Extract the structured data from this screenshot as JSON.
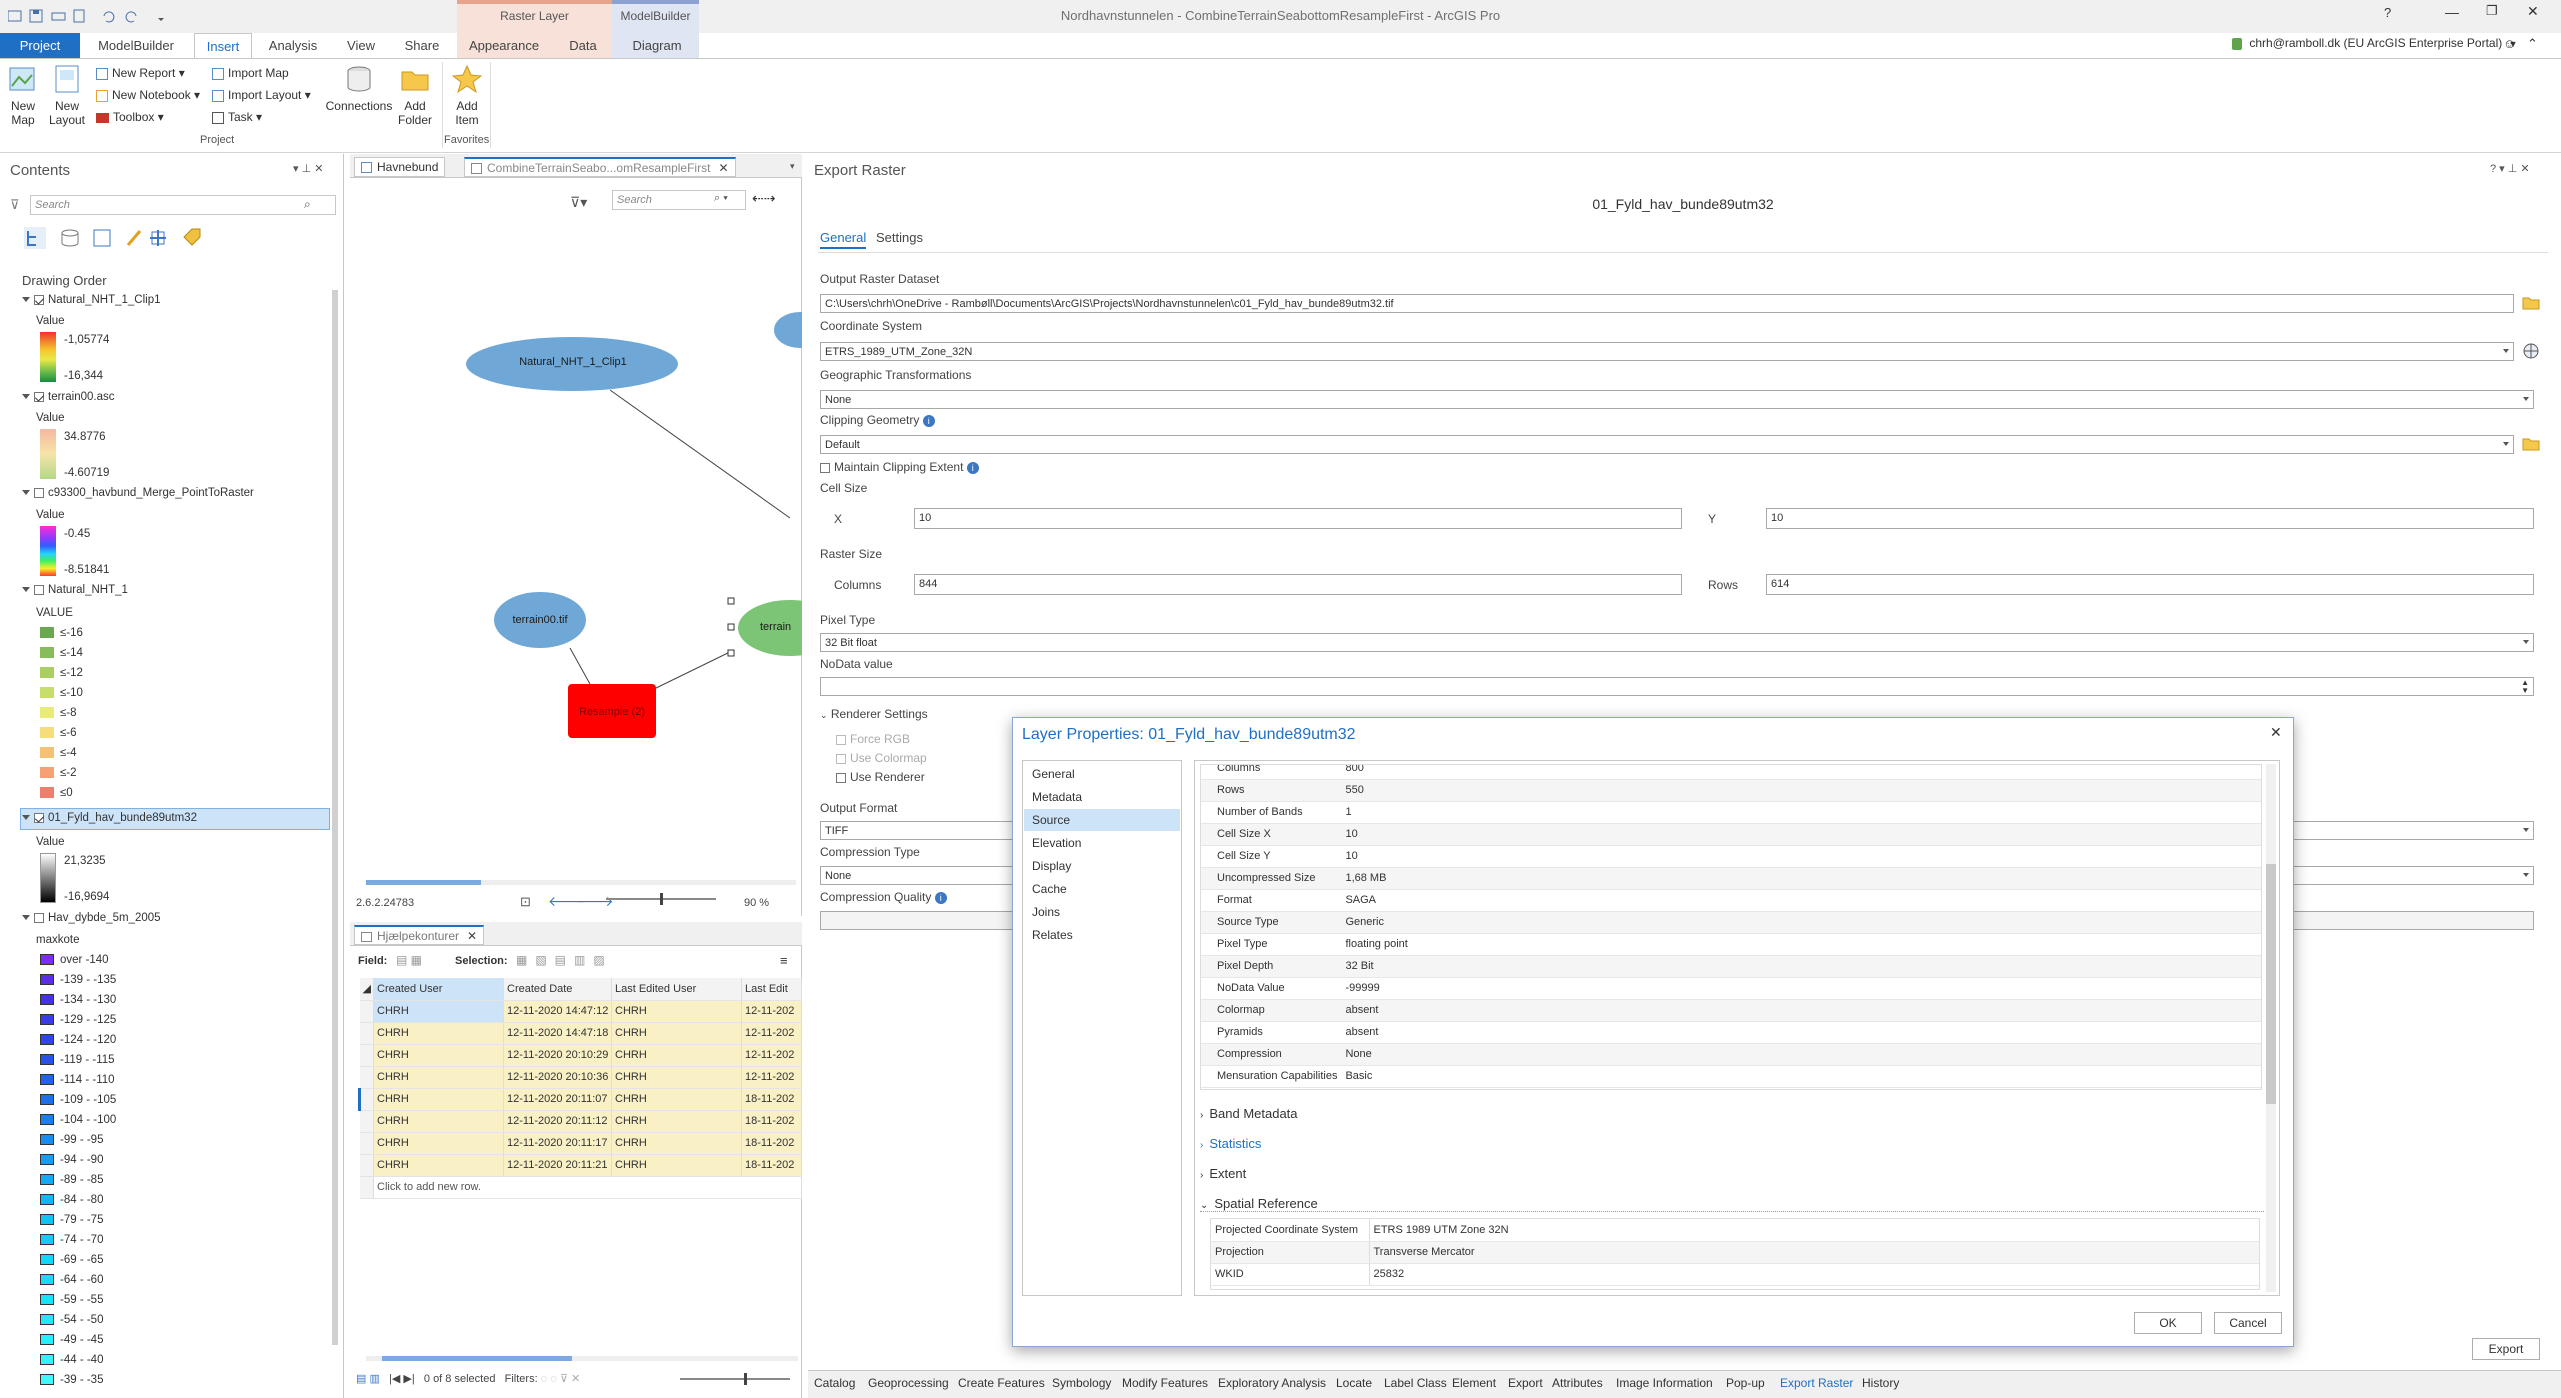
{
  "window": {
    "title": "Nordhavnstunnelen - CombineTerrainSeabottomResampleFirst - ArcGIS Pro",
    "help": "?"
  },
  "context_tabs": {
    "raster_layer": "Raster Layer",
    "modelbuilder": "ModelBuilder"
  },
  "tabs": [
    "Project",
    "ModelBuilder",
    "Insert",
    "Analysis",
    "View",
    "Share",
    "Appearance",
    "Data",
    "Diagram"
  ],
  "user": "chrh@ramboll.dk (EU ArcGIS Enterprise Portal)",
  "ribbon": {
    "new_map": [
      "New",
      "Map"
    ],
    "new_layout": [
      "New",
      "Layout"
    ],
    "new_report": "New Report",
    "new_notebook": "New Notebook",
    "toolbox": "Toolbox",
    "import_map": "Import Map",
    "import_layout": "Import Layout",
    "task": "Task",
    "connections": "Connections",
    "add_folder": [
      "Add",
      "Folder"
    ],
    "add_item": [
      "Add",
      "Item"
    ],
    "group_project": "Project",
    "group_favorites": "Favorites"
  },
  "contents": {
    "title": "Contents",
    "search_placeholder": "Search",
    "drawing_order": "Drawing Order",
    "layers": [
      {
        "name": "Natural_NHT_1_Clip1",
        "checked": true,
        "legend_title": "Value",
        "max": "-1,05774",
        "min": "-16,344"
      },
      {
        "name": "terrain00.asc",
        "checked": true,
        "legend_title": "Value",
        "max": "34.8776",
        "min": "-4.60719"
      },
      {
        "name": "c93300_havbund_Merge_PointToRaster",
        "checked": false,
        "legend_title": "Value",
        "max": "-0.45",
        "min": "-8.51841"
      },
      {
        "name": "Natural_NHT_1",
        "checked": false,
        "legend_title": "VALUE"
      },
      {
        "name": "01_Fyld_hav_bunde89utm32",
        "checked": true,
        "legend_title": "Value",
        "max": "21,3235",
        "min": "-16,9694"
      },
      {
        "name": "Hav_dybde_5m_2005",
        "checked": false,
        "legend_title": "maxkote"
      }
    ],
    "natural_classes": [
      {
        "label": "≤-16",
        "color": "#6aa84f"
      },
      {
        "label": "≤-14",
        "color": "#86bd5a"
      },
      {
        "label": "≤-12",
        "color": "#a9cf62"
      },
      {
        "label": "≤-10",
        "color": "#c8de6c"
      },
      {
        "label": "≤-8",
        "color": "#e8ec77"
      },
      {
        "label": "≤-6",
        "color": "#f6dc7a"
      },
      {
        "label": "≤-4",
        "color": "#f7c077"
      },
      {
        "label": "≤-2",
        "color": "#f5a173"
      },
      {
        "label": "≤0",
        "color": "#ee7f6c"
      }
    ],
    "hav_classes": [
      {
        "label": "over -140",
        "color": "#7b2bff"
      },
      {
        "label": "-139 - -135",
        "color": "#5a2ee6"
      },
      {
        "label": "-134 - -130",
        "color": "#4532e6"
      },
      {
        "label": "-129 - -125",
        "color": "#3a3be6"
      },
      {
        "label": "-124 - -120",
        "color": "#3344e6"
      },
      {
        "label": "-119 - -115",
        "color": "#2a52e8"
      },
      {
        "label": "-114 - -110",
        "color": "#2460ea"
      },
      {
        "label": "-109 - -105",
        "color": "#1f6eec"
      },
      {
        "label": "-104 - -100",
        "color": "#1b7eee"
      },
      {
        "label": "-99 - -95",
        "color": "#188df0"
      },
      {
        "label": "-94 - -90",
        "color": "#169cf2"
      },
      {
        "label": "-89 - -85",
        "color": "#14aaf3"
      },
      {
        "label": "-84 - -80",
        "color": "#12b6f4"
      },
      {
        "label": "-79 - -75",
        "color": "#11c2f5"
      },
      {
        "label": "-74 - -70",
        "color": "#10ccf6"
      },
      {
        "label": "-69 - -65",
        "color": "#10d6f7"
      },
      {
        "label": "-64 - -60",
        "color": "#12def8"
      },
      {
        "label": "-59 - -55",
        "color": "#16e5f8"
      },
      {
        "label": "-54 - -50",
        "color": "#1cebf9"
      },
      {
        "label": "-49 - -45",
        "color": "#24f0fa"
      },
      {
        "label": "-44 - -40",
        "color": "#30f4fb"
      },
      {
        "label": "-39 - -35",
        "color": "#40f7fb"
      }
    ]
  },
  "map_tabs": [
    "Havnebund",
    "CombineTerrainSeabo...omResampleFirst"
  ],
  "model": {
    "search_placeholder": "Search",
    "nodes": {
      "clip": "Natural_NHT_1_Clip1",
      "terrain": "terrain00.tif",
      "resample": "Resample (2)",
      "terrain_out": "terrain"
    },
    "scale": "2.6.2.24783",
    "zoom": "90 %"
  },
  "attr_table": {
    "tab": "Hjælpekonturer",
    "field_label": "Field:",
    "selection_label": "Selection:",
    "columns": [
      "Created User",
      "Created Date",
      "Last Edited User",
      "Last Edit"
    ],
    "rows": [
      [
        "CHRH",
        "12-11-2020 14:47:12",
        "CHRH",
        "12-11-202"
      ],
      [
        "CHRH",
        "12-11-2020 14:47:18",
        "CHRH",
        "12-11-202"
      ],
      [
        "CHRH",
        "12-11-2020 20:10:29",
        "CHRH",
        "12-11-202"
      ],
      [
        "CHRH",
        "12-11-2020 20:10:36",
        "CHRH",
        "12-11-202"
      ],
      [
        "CHRH",
        "12-11-2020 20:11:07",
        "CHRH",
        "18-11-202"
      ],
      [
        "CHRH",
        "12-11-2020 20:11:12",
        "CHRH",
        "18-11-202"
      ],
      [
        "CHRH",
        "12-11-2020 20:11:17",
        "CHRH",
        "18-11-202"
      ],
      [
        "CHRH",
        "12-11-2020 20:11:21",
        "CHRH",
        "18-11-202"
      ]
    ],
    "add_row": "Click to add new row.",
    "status": "0 of 8 selected",
    "filters": "Filters:"
  },
  "export": {
    "title": "Export Raster",
    "subtitle": "01_Fyld_hav_bunde89utm32",
    "tab_general": "General",
    "tab_settings": "Settings",
    "output_label": "Output Raster Dataset",
    "output_value": "C:\\Users\\chrh\\OneDrive - Rambøll\\Documents\\ArcGIS\\Projects\\Nordhavnstunnelen\\c01_Fyld_hav_bunde89utm32.tif",
    "cs_label": "Coordinate System",
    "cs_value": "ETRS_1989_UTM_Zone_32N",
    "geo_label": "Geographic Transformations",
    "geo_value": "None",
    "clip_label": "Clipping Geometry",
    "clip_value": "Default",
    "maintain": "Maintain Clipping Extent",
    "cell_label": "Cell Size",
    "x_label": "X",
    "x_value": "10",
    "y_label": "Y",
    "y_value": "10",
    "rsize_label": "Raster Size",
    "cols_label": "Columns",
    "cols_value": "844",
    "rows_label": "Rows",
    "rows_value": "614",
    "pixel_label": "Pixel Type",
    "pixel_value": "32 Bit float",
    "nodata_label": "NoData value",
    "renderer_label": "Renderer Settings",
    "force_rgb": "Force RGB",
    "use_colormap": "Use Colormap",
    "use_renderer": "Use Renderer",
    "format_label": "Output Format",
    "format_value": "TIFF",
    "comp_label": "Compression Type",
    "comp_value": "None",
    "quality_label": "Compression Quality",
    "export_button": "Export"
  },
  "props": {
    "title": "Layer Properties: 01_Fyld_hav_bunde89utm32",
    "nav": [
      "General",
      "Metadata",
      "Source",
      "Elevation",
      "Display",
      "Cache",
      "Joins",
      "Relates"
    ],
    "selected_nav": "Source",
    "rows": [
      [
        "Columns",
        "800"
      ],
      [
        "Rows",
        "550"
      ],
      [
        "Number of Bands",
        "1"
      ],
      [
        "Cell Size X",
        "10"
      ],
      [
        "Cell Size Y",
        "10"
      ],
      [
        "Uncompressed Size",
        "1,68 MB"
      ],
      [
        "Format",
        "SAGA"
      ],
      [
        "Source Type",
        "Generic"
      ],
      [
        "Pixel Type",
        "floating point"
      ],
      [
        "Pixel Depth",
        "32 Bit"
      ],
      [
        "NoData Value",
        "-99999"
      ],
      [
        "Colormap",
        "absent"
      ],
      [
        "Pyramids",
        "absent"
      ],
      [
        "Compression",
        "None"
      ],
      [
        "Mensuration Capabilities",
        "Basic"
      ]
    ],
    "sections": [
      "Band Metadata",
      "Statistics",
      "Extent",
      "Spatial Reference"
    ],
    "sr_rows": [
      [
        "Projected Coordinate System",
        "ETRS 1989 UTM Zone 32N"
      ],
      [
        "Projection",
        "Transverse Mercator"
      ],
      [
        "WKID",
        "25832"
      ]
    ],
    "ok": "OK",
    "cancel": "Cancel"
  },
  "bottom_tabs": [
    "Catalog",
    "Geoprocessing",
    "Create Features",
    "Symbology",
    "Modify Features",
    "Exploratory Analysis",
    "Locate",
    "Label Class",
    "Element",
    "Export",
    "Attributes",
    "Image Information",
    "Pop-up",
    "Export Raster",
    "History"
  ],
  "active_bottom_tab": "Export Raster",
  "colors": {
    "accent": "#1f6fc5",
    "selection": "#cde3f7",
    "row_yellow": "#f9f0c5"
  }
}
